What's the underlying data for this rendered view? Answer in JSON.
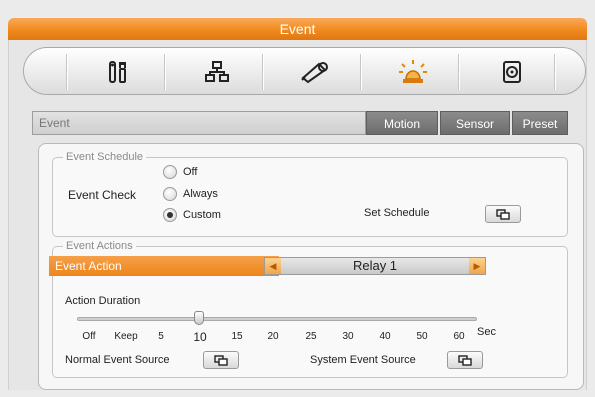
{
  "window": {
    "title": "Event"
  },
  "toolbar": {
    "items": [
      {
        "icon": "tools-icon"
      },
      {
        "icon": "network-icon"
      },
      {
        "icon": "camera-icon"
      },
      {
        "icon": "alarm-light-icon",
        "active": true
      },
      {
        "icon": "storage-icon"
      }
    ]
  },
  "tabs": {
    "field_label": "Event",
    "items": [
      "Motion",
      "Sensor",
      "Preset"
    ]
  },
  "schedule": {
    "legend": "Event Schedule",
    "event_check_label": "Event Check",
    "options": [
      "Off",
      "Always",
      "Custom"
    ],
    "selected": "Custom",
    "set_schedule_label": "Set Schedule"
  },
  "actions": {
    "legend": "Event Actions",
    "event_action_label": "Event Action",
    "relay_value": "Relay 1",
    "duration_label": "Action Duration",
    "duration_ticks": [
      "Off",
      "Keep",
      "5",
      "10",
      "15",
      "20",
      "25",
      "30",
      "40",
      "50",
      "60"
    ],
    "duration_selected": "10",
    "duration_unit": "Sec",
    "normal_source_label": "Normal Event Source",
    "system_source_label": "System Event Source"
  },
  "colors": {
    "accent": "#f08a1e",
    "tab_bg": "#6d6d6d"
  }
}
